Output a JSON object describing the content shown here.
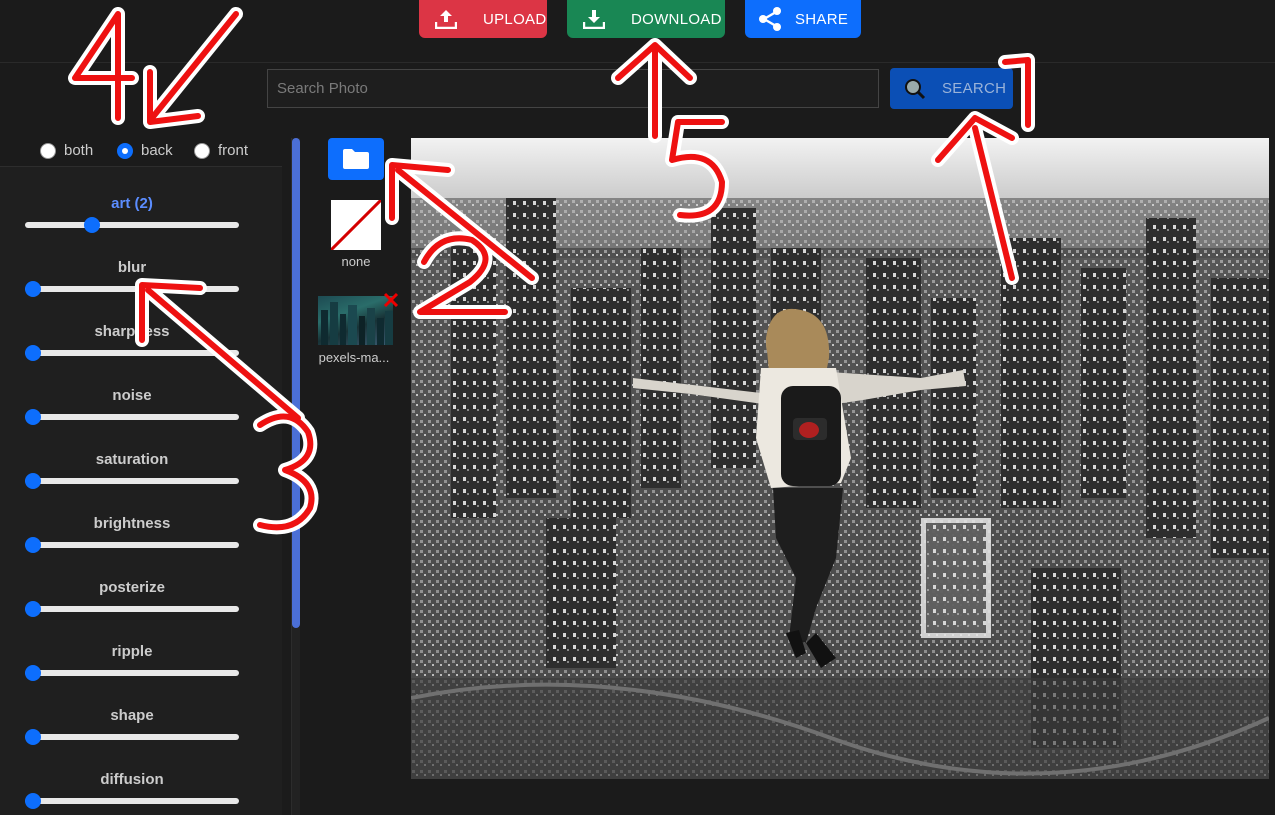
{
  "toolbar": {
    "upload_label": "UPLOAD",
    "download_label": "DOWNLOAD",
    "share_label": "SHARE"
  },
  "search": {
    "placeholder": "Search Photo",
    "value": "",
    "button_label": "SEARCH"
  },
  "layer_mode": {
    "options": [
      "both",
      "back",
      "front"
    ],
    "selected": "back"
  },
  "sliders": [
    {
      "label": "art (2)",
      "value": 0.3,
      "active": true
    },
    {
      "label": "blur",
      "value": 0,
      "active": false
    },
    {
      "label": "sharpness",
      "value": 0,
      "active": false
    },
    {
      "label": "noise",
      "value": 0,
      "active": false
    },
    {
      "label": "saturation",
      "value": 0,
      "active": false
    },
    {
      "label": "brightness",
      "value": 0,
      "active": false
    },
    {
      "label": "posterize",
      "value": 0,
      "active": false
    },
    {
      "label": "ripple",
      "value": 0,
      "active": false
    },
    {
      "label": "shape",
      "value": 0,
      "active": false
    },
    {
      "label": "diffusion",
      "value": 0,
      "active": false
    }
  ],
  "backgrounds": [
    {
      "label": "none"
    },
    {
      "label": "pexels-ma..."
    }
  ],
  "annotations": [
    "1",
    "2",
    "3",
    "4",
    "5"
  ],
  "colors": {
    "upload": "#dc3545",
    "download": "#198754",
    "share": "#0d6efd",
    "annotation": "#ff0000"
  }
}
